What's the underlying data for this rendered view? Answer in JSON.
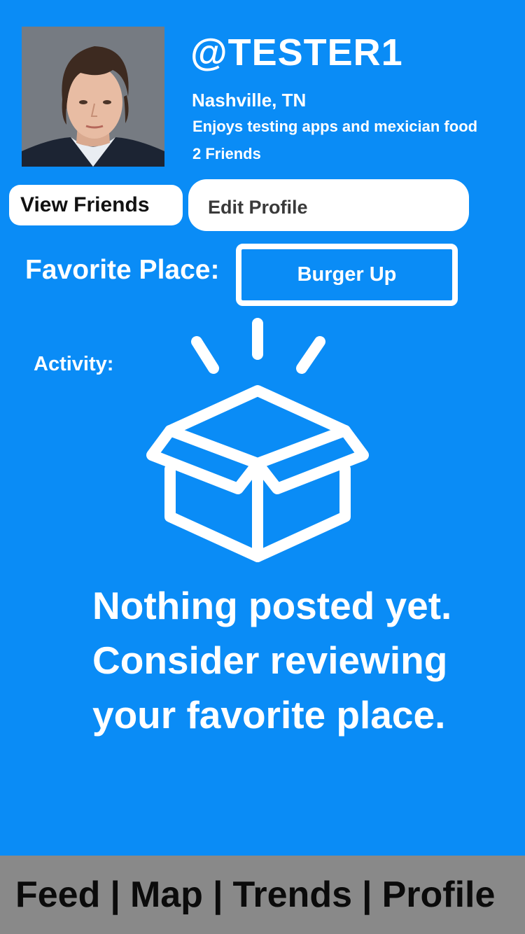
{
  "profile": {
    "username": "@TESTER1",
    "location": "Nashville, TN",
    "bio": "Enjoys testing apps and mexician food",
    "friends_count": "2 Friends"
  },
  "actions": {
    "view_friends": "View Friends",
    "edit_profile": "Edit Profile"
  },
  "favorite": {
    "label": "Favorite Place:",
    "place": "Burger Up"
  },
  "activity": {
    "label": "Activity:",
    "empty_icon": "open-box-icon",
    "empty_lines": [
      "Nothing posted yet.",
      "Consider reviewing",
      "your favorite place."
    ]
  },
  "nav": {
    "items": [
      "Feed",
      "Map",
      "Trends",
      "Profile"
    ],
    "separator": "|"
  },
  "colors": {
    "background": "#0a8cf6",
    "nav_background": "#898989",
    "button_background": "#ffffff"
  }
}
